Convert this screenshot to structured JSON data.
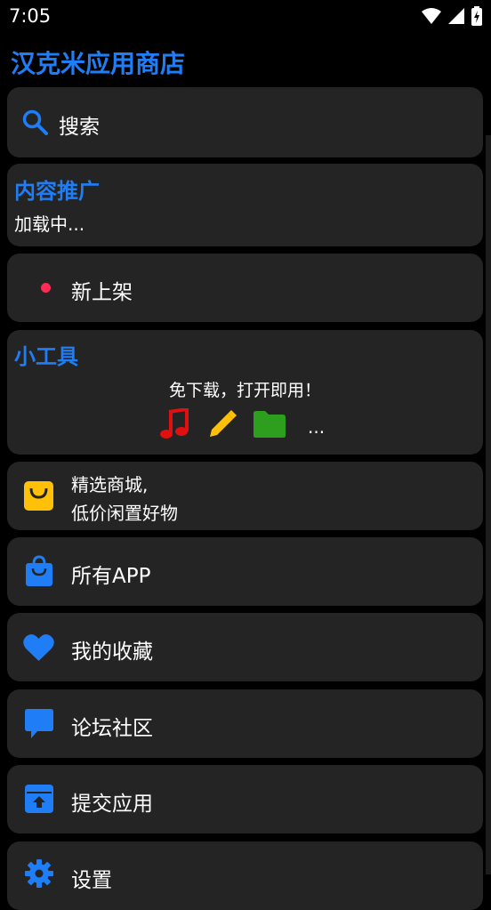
{
  "status": {
    "time": "7:05"
  },
  "app": {
    "title": "汉克米应用商店"
  },
  "search": {
    "placeholder": "搜索"
  },
  "promo": {
    "title": "内容推广",
    "status": "加载中..."
  },
  "new_arrivals": {
    "label": "新上架",
    "dot_color": "#ff2a55"
  },
  "tools": {
    "title": "小工具",
    "subtitle": "免下载，打开即用！",
    "more": "...",
    "icons": [
      "music-note-icon",
      "pencil-icon",
      "folder-icon"
    ]
  },
  "shop": {
    "line1": "精选商城,",
    "line2": "低价闲置好物",
    "icon": "shopping-bag-icon"
  },
  "menu": [
    {
      "label": "所有APP",
      "icon": "shopping-bag-icon"
    },
    {
      "label": "我的收藏",
      "icon": "heart-icon"
    },
    {
      "label": "论坛社区",
      "icon": "chat-icon"
    },
    {
      "label": "提交应用",
      "icon": "upload-box-icon"
    },
    {
      "label": "设置",
      "icon": "gear-icon"
    }
  ],
  "colors": {
    "accent": "#1f7ef5",
    "card": "#242424",
    "background": "#000000",
    "yellow": "#ffc107",
    "red": "#e01010",
    "green": "#2e9e1e"
  }
}
